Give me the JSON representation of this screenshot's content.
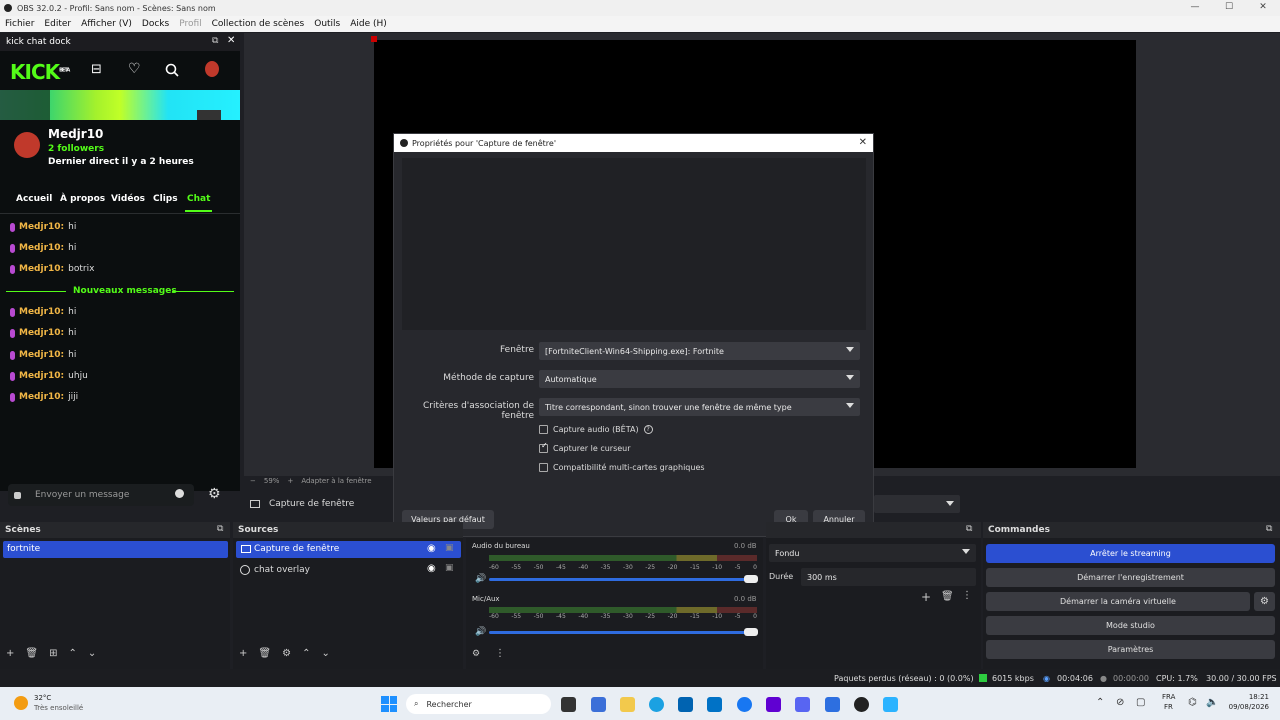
{
  "window": {
    "title": "OBS 32.0.2 - Profil: Sans nom - Scènes: Sans nom"
  },
  "menu": [
    "Fichier",
    "Editer",
    "Afficher (V)",
    "Docks",
    "Profil",
    "Collection de scènes",
    "Outils",
    "Aide (H)"
  ],
  "dock": {
    "title": "kick chat dock"
  },
  "kick": {
    "logo": "KICK",
    "beta": "BETA",
    "channel": "Medjr10",
    "followers": "2 followers",
    "last_live": "Dernier direct il y a 2 heures",
    "tabs": [
      "Accueil",
      "À propos",
      "Vidéos",
      "Clips",
      "Chat"
    ],
    "messages_before": [
      {
        "user": "Medjr10:",
        "text": "hi"
      },
      {
        "user": "Medjr10:",
        "text": "hi"
      },
      {
        "user": "Medjr10:",
        "text": "botrix"
      }
    ],
    "new_messages_label": "Nouveaux messages",
    "messages_after": [
      {
        "user": "Medjr10:",
        "text": "hi"
      },
      {
        "user": "Medjr10:",
        "text": "hi"
      },
      {
        "user": "Medjr10:",
        "text": "hi"
      },
      {
        "user": "Medjr10:",
        "text": "uhju"
      },
      {
        "user": "Medjr10:",
        "text": "jiji"
      }
    ],
    "input_placeholder": "Envoyer un message"
  },
  "preview": {
    "zoom": "59%",
    "fit": "Adapter à la fenêtre",
    "source_name": "Capture de fenêtre"
  },
  "dialog": {
    "title": "Propriétés pour 'Capture de fenêtre'",
    "fenetre_label": "Fenêtre",
    "fenetre_value": "[FortniteClient-Win64-Shipping.exe]: Fortnite",
    "methode_label": "Méthode de capture",
    "methode_value": "Automatique",
    "criteres_label": "Critères d'association de fenêtre",
    "criteres_value": "Titre correspondant, sinon trouver une fenêtre de même type",
    "cb_audio": "Capture audio (BÊTA)",
    "cb_audio_checked": false,
    "cb_cursor": "Capturer le curseur",
    "cb_cursor_checked": true,
    "cb_multi": "Compatibilité multi-cartes graphiques",
    "cb_multi_checked": false,
    "defaults": "Valeurs par défaut",
    "ok": "Ok",
    "cancel": "Annuler"
  },
  "scenes": {
    "title": "Scènes",
    "items": [
      "fortnite"
    ]
  },
  "sources": {
    "title": "Sources",
    "items": [
      "Capture de fenêtre",
      "chat overlay"
    ]
  },
  "mixer": {
    "tracks": [
      {
        "name": "Audio du bureau",
        "level": "0.0 dB"
      },
      {
        "name": "Mic/Aux",
        "level": "0.0 dB"
      }
    ],
    "ticks": [
      "-60",
      "-55",
      "-50",
      "-45",
      "-40",
      "-35",
      "-30",
      "-25",
      "-20",
      "-15",
      "-10",
      "-5",
      "0"
    ]
  },
  "transitions": {
    "type": "Fondu",
    "duration_label": "Durée",
    "duration": "300 ms"
  },
  "commands": {
    "title": "Commandes",
    "buttons": [
      "Arrêter le streaming",
      "Démarrer l'enregistrement",
      "Démarrer la caméra virtuelle",
      "Mode studio",
      "Paramètres"
    ]
  },
  "status": {
    "dropped": "Paquets perdus (réseau) : 0 (0.0%)",
    "bitrate": "6015 kbps",
    "stream_time": "00:04:06",
    "rec_time": "00:00:00",
    "cpu": "CPU: 1.7%",
    "fps": "30.00 / 30.00 FPS"
  },
  "taskbar": {
    "temp": "32°C",
    "weather": "Très ensoleillé",
    "search": "Rechercher",
    "lang1": "FRA",
    "lang2": "FR",
    "time": "18:21",
    "date": "09/08/2026"
  }
}
